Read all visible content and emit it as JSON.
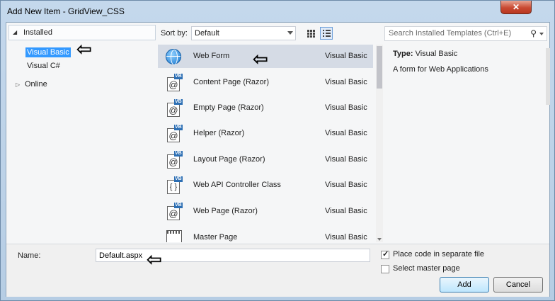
{
  "window": {
    "title": "Add New Item - GridView_CSS",
    "close_glyph": "✕"
  },
  "tree": {
    "header": "Installed",
    "items": [
      "Visual Basic",
      "Visual C#"
    ],
    "online": "Online"
  },
  "sortbar": {
    "label": "Sort by:",
    "selected": "Default"
  },
  "search": {
    "placeholder": "Search Installed Templates (Ctrl+E)"
  },
  "templates": [
    {
      "name": "Web Form",
      "language": "Visual Basic",
      "icon": "globe-icon"
    },
    {
      "name": "Content Page (Razor)",
      "language": "Visual Basic",
      "icon": "razor-page-icon"
    },
    {
      "name": "Empty Page (Razor)",
      "language": "Visual Basic",
      "icon": "razor-page-icon"
    },
    {
      "name": "Helper (Razor)",
      "language": "Visual Basic",
      "icon": "razor-page-icon"
    },
    {
      "name": "Layout Page (Razor)",
      "language": "Visual Basic",
      "icon": "razor-page-icon"
    },
    {
      "name": "Web API Controller Class",
      "language": "Visual Basic",
      "icon": "controller-class-icon"
    },
    {
      "name": "Web Page (Razor)",
      "language": "Visual Basic",
      "icon": "razor-page-icon"
    },
    {
      "name": "Master Page",
      "language": "Visual Basic",
      "icon": "master-page-icon"
    }
  ],
  "details": {
    "type_label": "Type:",
    "type_value": "Visual Basic",
    "description": "A form for Web Applications"
  },
  "bottom": {
    "name_label": "Name:",
    "name_value": "Default.aspx",
    "opt_separate": "Place code in separate file",
    "opt_separate_checked": true,
    "opt_master": "Select master page",
    "opt_master_checked": false,
    "add": "Add",
    "cancel": "Cancel"
  },
  "annotation_glyph": "⇦",
  "colors": {
    "selection": "#3399ff",
    "row_selected": "#d5dbe5",
    "close": "#c94a33"
  }
}
